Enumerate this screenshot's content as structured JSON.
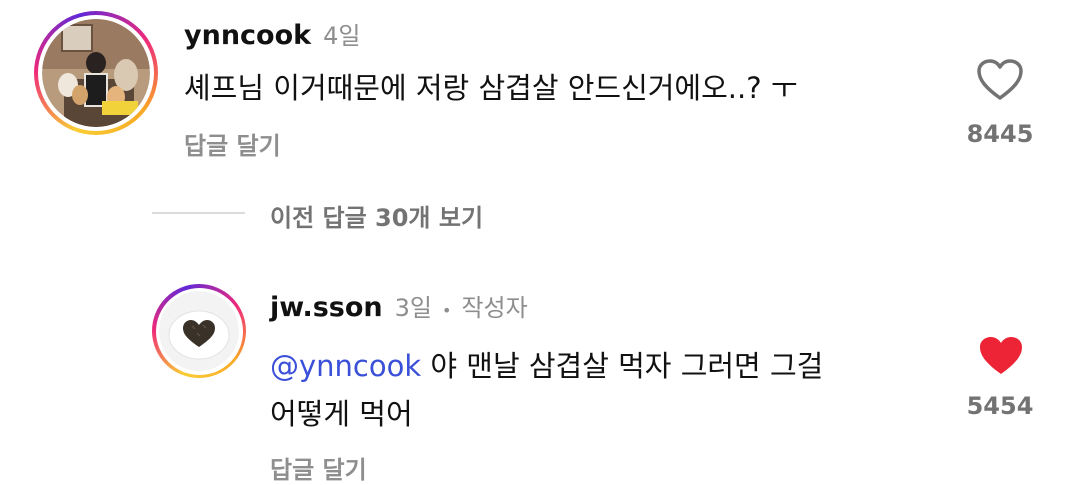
{
  "comments": [
    {
      "username": "ynncook",
      "time": "4일",
      "text": "셰프님 이거때문에 저랑 삼겹살 안드신거에오..? ㅜ",
      "reply_label": "답글 달기",
      "like_count": "8445",
      "liked": false,
      "avatar_icon": "person-with-dogs-photo"
    },
    {
      "username": "jw.sson",
      "time": "3일",
      "separator": "•",
      "author_badge": "작성자",
      "mention": "@ynncook",
      "text_line1": " 야 맨날 삼겹살 먹자 그러면 그걸",
      "text_line2": "어떻게 먹어",
      "reply_label": "답글 달기",
      "like_count": "5454",
      "liked": true,
      "avatar_icon": "heart-shaped-food-photo"
    }
  ],
  "view_previous": "이전 답글 30개 보기",
  "colors": {
    "like_active": "#ed2436",
    "mention": "#3b50d9",
    "muted": "#8e8e8e"
  }
}
